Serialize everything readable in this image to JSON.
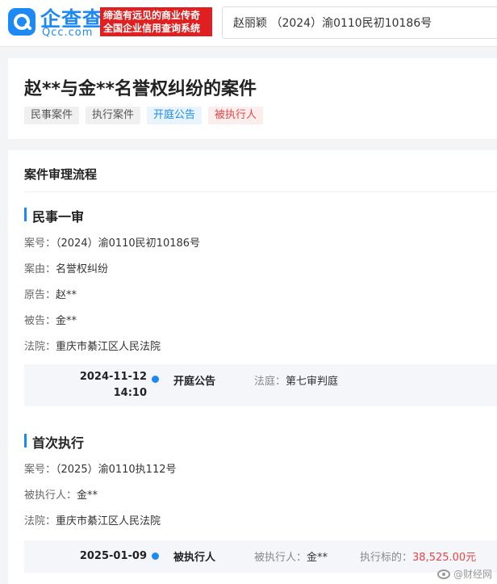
{
  "header": {
    "logo_cn": "企查查",
    "logo_en": "Qcc.com",
    "slogan_line1": "缔造有远见的商业传奇",
    "slogan_line2": "全国企业信用查询系统",
    "search_value": "赵丽颖 （2024）渝0110民初10186号"
  },
  "case": {
    "title": "赵**与金**名誉权纠纷的案件",
    "tags": [
      "民事案件",
      "执行案件",
      "开庭公告",
      "被执行人"
    ]
  },
  "flow": {
    "title": "案件审理流程",
    "sections": [
      {
        "heading": "民事一审",
        "fields": [
          {
            "label": "案号：",
            "value": "（2024）渝0110民初10186号"
          },
          {
            "label": "案由：",
            "value": "名誉权纠纷"
          },
          {
            "label": "原告：",
            "value": "赵**"
          },
          {
            "label": "被告：",
            "value": "金**"
          },
          {
            "label": "法院：",
            "value": "重庆市綦江区人民法院"
          }
        ],
        "timeline": {
          "date": "2024-11-12",
          "time": "14:10",
          "type": "开庭公告",
          "info_label": "法庭：",
          "info_value": "第七审判庭"
        }
      },
      {
        "heading": "首次执行",
        "fields": [
          {
            "label": "案号：",
            "value": "（2025）渝0110执112号"
          },
          {
            "label": "被执行人：",
            "value": "金**"
          },
          {
            "label": "法院：",
            "value": "重庆市綦江区人民法院"
          }
        ],
        "timeline": {
          "date": "2025-01-09",
          "type": "被执行人",
          "info_label": "被执行人：",
          "info_value": "金**",
          "amount_label": "执行标的：",
          "amount_value": "38,525.00元"
        }
      }
    ]
  },
  "watermark": "@财经网",
  "colors": {
    "brand_blue": "#1d89f5",
    "slogan_red": "#e02020",
    "amount_red": "#e84545"
  }
}
